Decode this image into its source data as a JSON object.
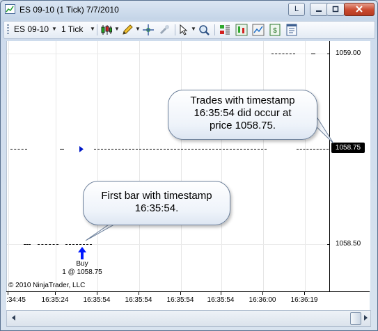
{
  "window": {
    "title": "ES 09-10 (1 Tick)  7/7/2010",
    "controls": {
      "special": "L",
      "minimize": "minimize",
      "maximize": "maximize",
      "close": "close"
    }
  },
  "toolbar": {
    "instrument": "ES 09-10",
    "interval": "1 Tick",
    "icons": [
      "candlestick-icon",
      "pencil-icon",
      "crosshair-icon",
      "hide-icon",
      "cursor-icon",
      "zoom-icon",
      "chart-trader-icon",
      "strategy-icon",
      "indicator-icon",
      "data-box-icon",
      "properties-icon"
    ]
  },
  "price_axis": {
    "labels": [
      "1059.00",
      "1058.50"
    ],
    "current_price": "1058.75"
  },
  "time_axis": {
    "labels": [
      ":34:45",
      "16:35:24",
      "16:35:54",
      "16:35:54",
      "16:35:54",
      "16:35:54",
      "16:36:00",
      "16:36:19"
    ]
  },
  "chart": {
    "copyright": "© 2010 NinjaTrader, LLC",
    "execution": {
      "label_line1": "Buy",
      "label_line2": "1 @ 1058.75"
    },
    "colors": {
      "buy_arrow": "#0018ff",
      "marker": "#0018c8",
      "price_line": "#000000"
    }
  },
  "callouts": {
    "top": {
      "line1": "Trades with timestamp",
      "line2": "16:35:54 did occur at",
      "line3": "price 1058.75."
    },
    "bottom": {
      "line1": "First bar with timestamp",
      "line2": "16:35:54."
    }
  }
}
